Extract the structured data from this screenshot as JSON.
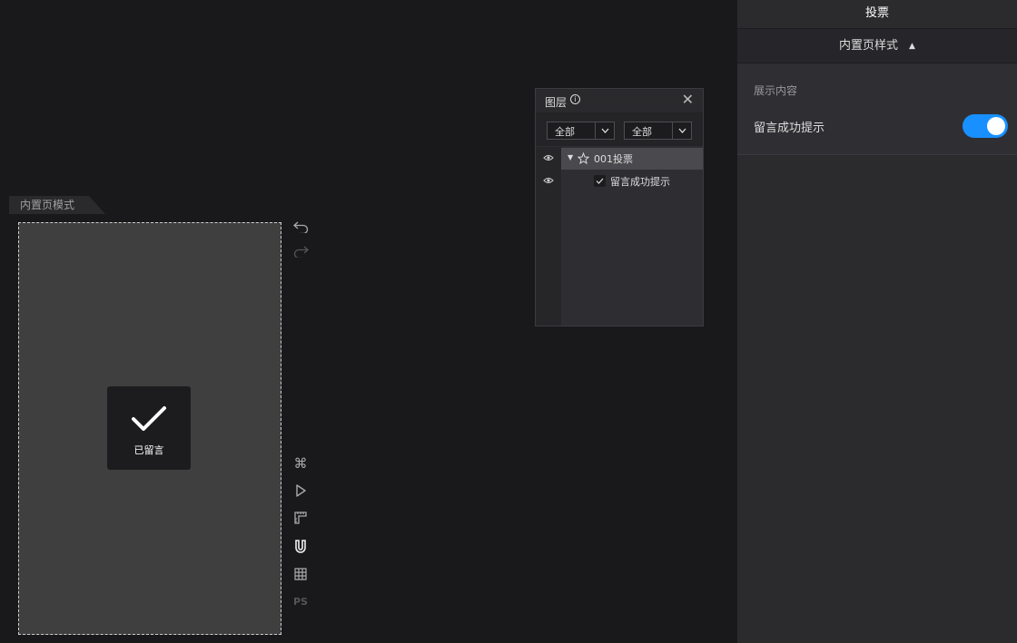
{
  "canvas": {
    "mode_tag": "内置页模式",
    "toast_text": "已留言"
  },
  "tools": {
    "undo_icon": "undo-icon",
    "redo_icon": "redo-icon",
    "command_icon": "command-icon",
    "play_icon": "play-icon",
    "ruler_icon": "ruler-icon",
    "magnet_icon": "magnet-icon",
    "grid_icon": "grid-icon",
    "ps_label": "PS"
  },
  "layers": {
    "title": "图层",
    "filter1": "全部",
    "filter2": "全部",
    "items": [
      {
        "label": "001投票",
        "icon": "component-icon"
      },
      {
        "label": "留言成功提示",
        "icon": "check-layer-icon"
      }
    ]
  },
  "right_panel": {
    "title": "投票",
    "section_title": "内置页样式",
    "subtitle": "展示内容",
    "toggle_label": "留言成功提示",
    "toggle_on": true,
    "accent_color": "#1890ff"
  }
}
